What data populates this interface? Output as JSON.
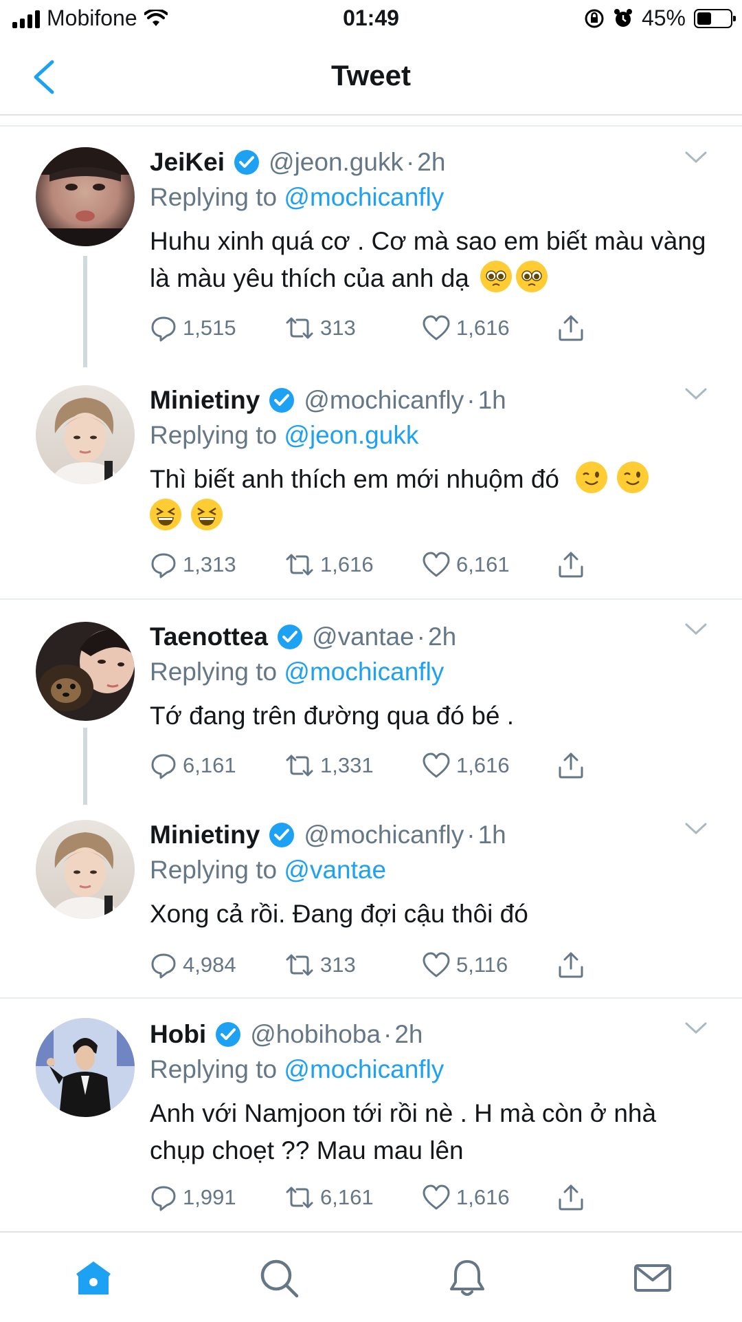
{
  "status_bar": {
    "carrier": "Mobifone",
    "time": "01:49",
    "battery": "45%"
  },
  "nav": {
    "title": "Tweet"
  },
  "colors": {
    "accent": "#1da1f2",
    "secondary_text": "#657786",
    "divider": "#e6ecf0"
  },
  "tweets": [
    {
      "name": "JeiKei",
      "handle": "@jeon.gukk",
      "time": "2h",
      "replying_prefix": "Replying to",
      "replying_to": "@mochicanfly",
      "text": "Huhu xinh quá cơ . Cơ mà sao em biết màu vàng là màu yêu thích của anh dạ",
      "emojis": [
        "pleading-face",
        "pleading-face"
      ],
      "replies": "1,515",
      "retweets": "313",
      "likes": "1,616"
    },
    {
      "name": "Minietiny",
      "handle": "@mochicanfly",
      "time": "1h",
      "replying_prefix": "Replying to",
      "replying_to": "@jeon.gukk",
      "text": "Thì biết anh thích em mới nhuộm đó",
      "emojis": [
        "winking-face",
        "winking-face",
        "grinning-squinting-face",
        "grinning-squinting-face"
      ],
      "replies": "1,313",
      "retweets": "1,616",
      "likes": "6,161"
    },
    {
      "name": "Taenottea",
      "handle": "@vantae",
      "time": "2h",
      "replying_prefix": "Replying to",
      "replying_to": "@mochicanfly",
      "text": "Tớ đang trên đường qua đó bé .",
      "replies": "6,161",
      "retweets": "1,331",
      "likes": "1,616"
    },
    {
      "name": "Minietiny",
      "handle": "@mochicanfly",
      "time": "1h",
      "replying_prefix": "Replying to",
      "replying_to": "@vantae",
      "text": "Xong cả rồi. Đang đợi cậu thôi đó",
      "replies": "4,984",
      "retweets": "313",
      "likes": "5,116"
    },
    {
      "name": "Hobi",
      "handle": "@hobihoba",
      "time": "2h",
      "replying_prefix": "Replying to",
      "replying_to": "@mochicanfly",
      "text": "Anh với Namjoon tới rồi nè . H mà còn ở nhà chụp choẹt ?? Mau mau lên",
      "replies": "1,991",
      "retweets": "6,161",
      "likes": "1,616"
    }
  ]
}
